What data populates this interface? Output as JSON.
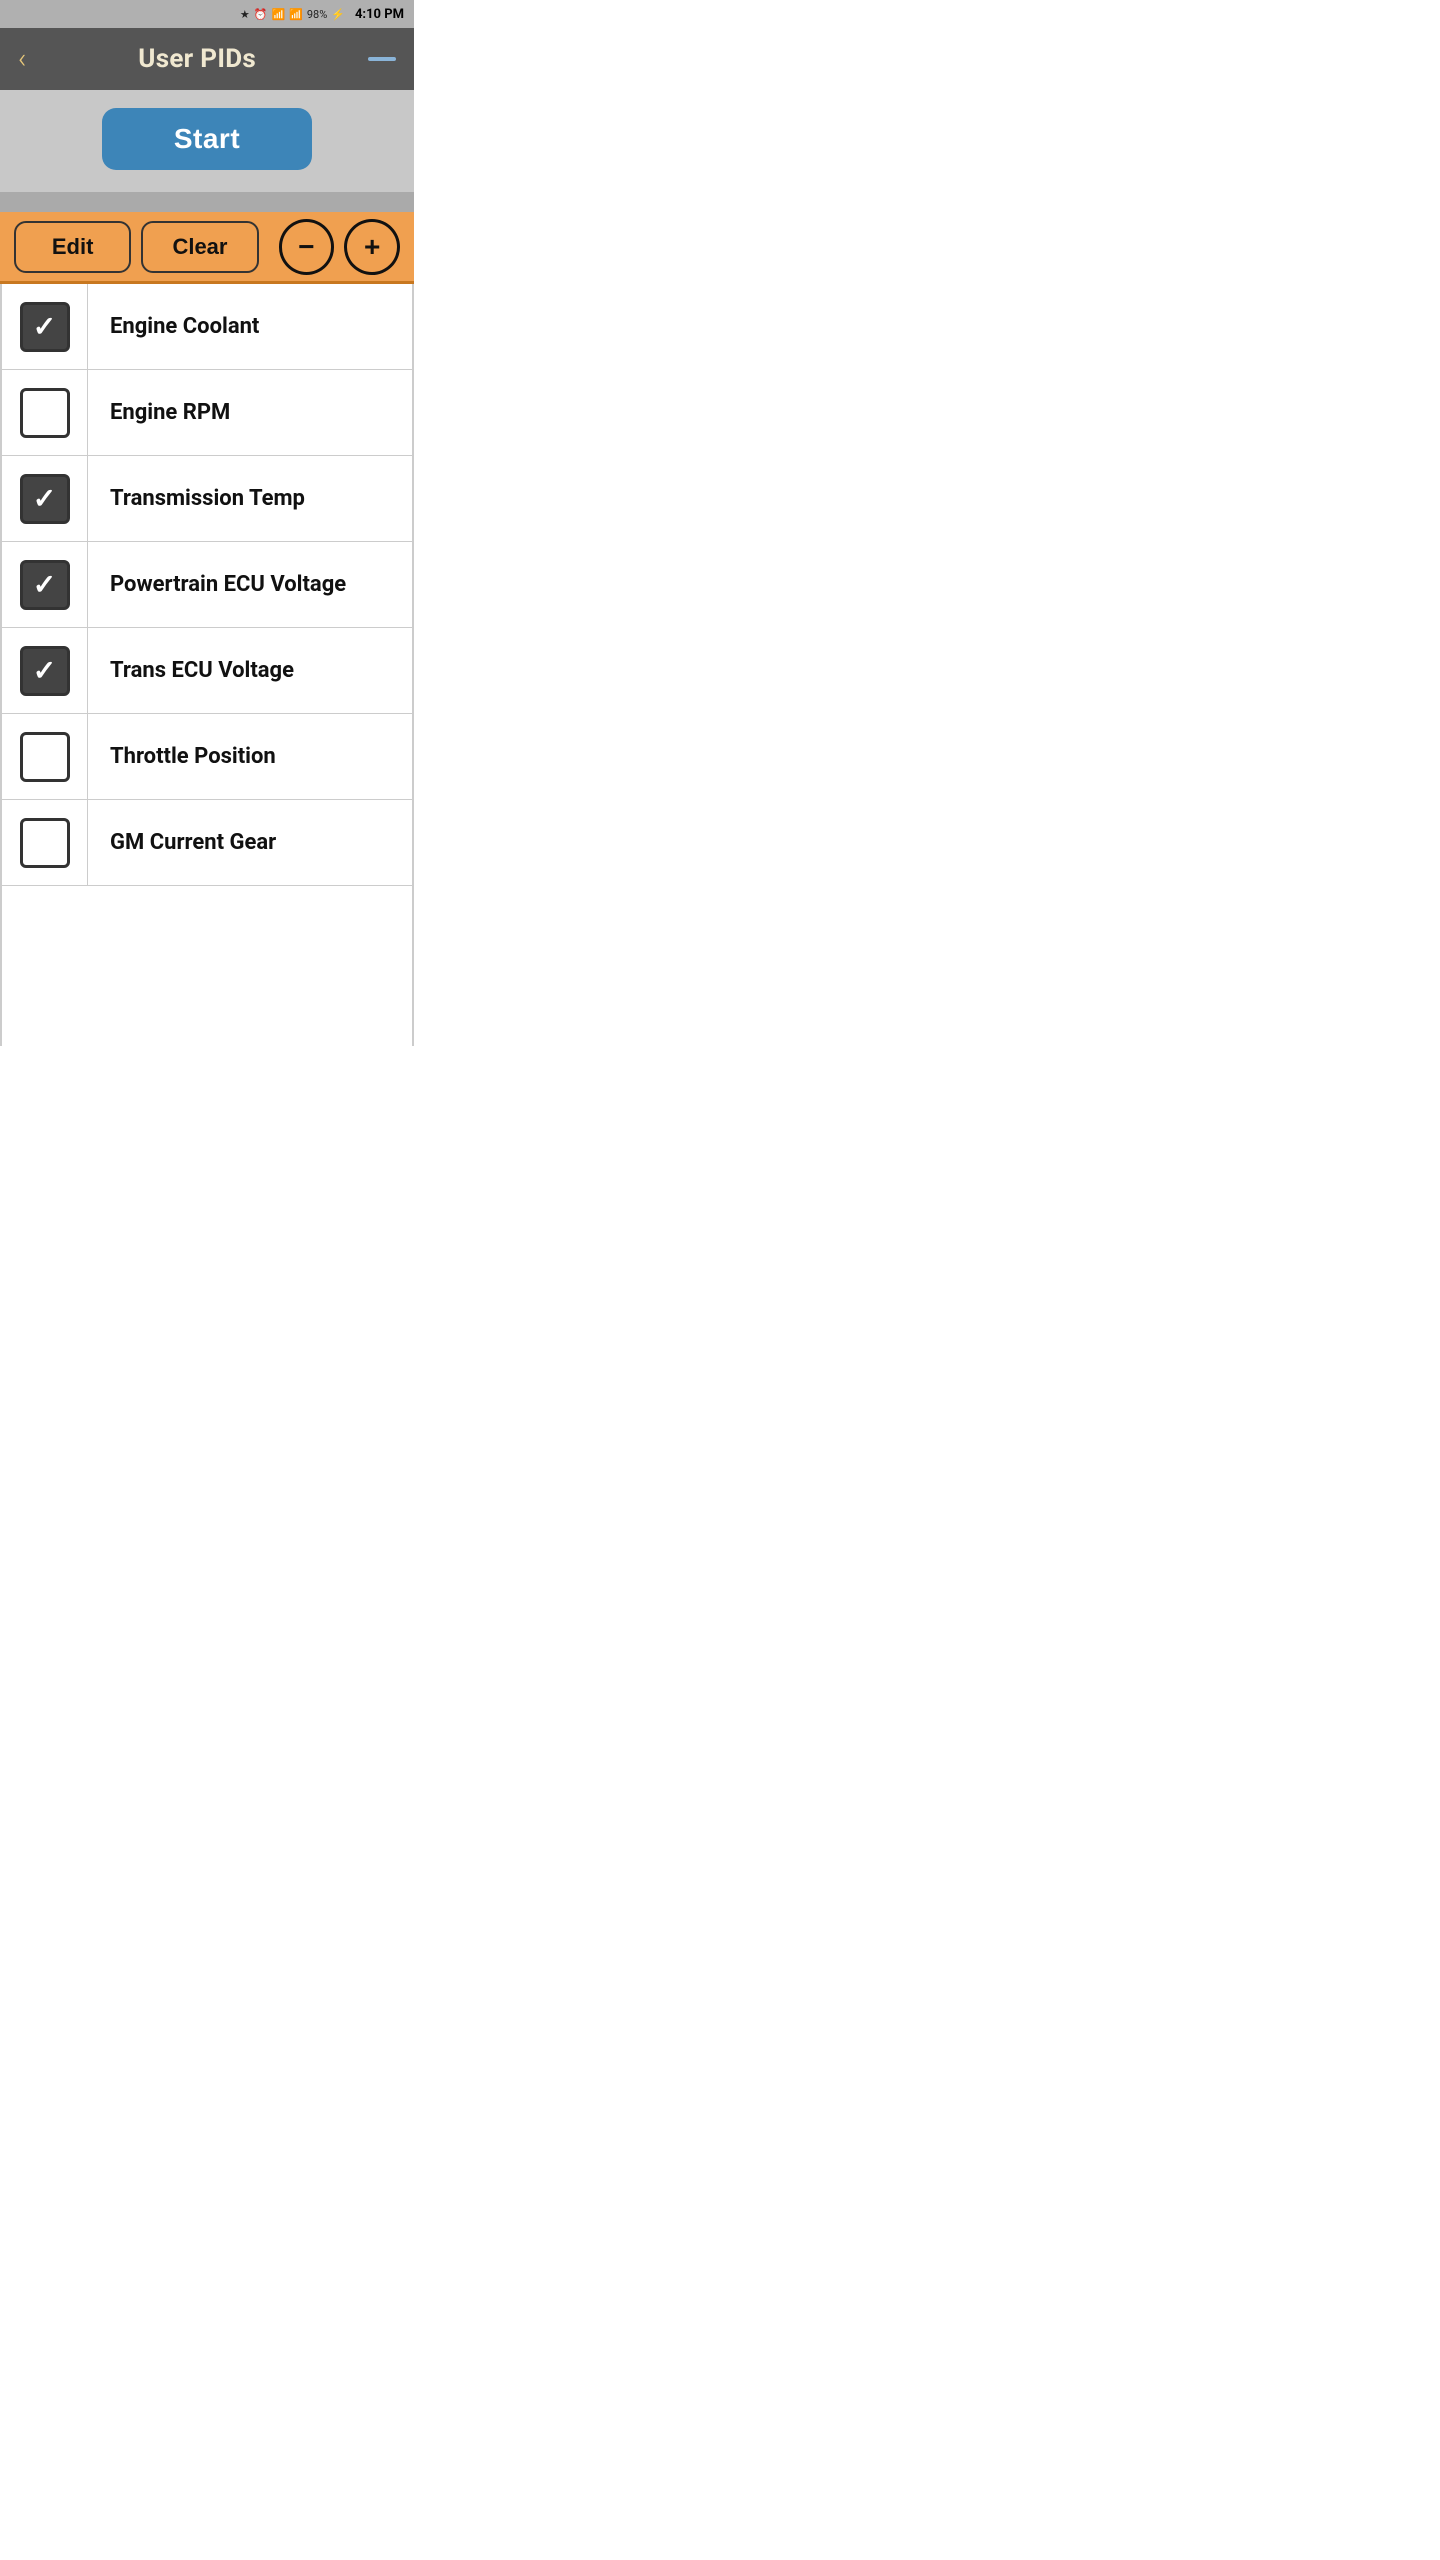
{
  "statusBar": {
    "battery": "98%",
    "time": "4:10 PM",
    "icons": [
      "bluetooth",
      "alarm",
      "wifi",
      "signal-bars"
    ]
  },
  "navBar": {
    "title": "User PIDs",
    "backLabel": "‹",
    "minimizeLabel": "—"
  },
  "startButton": {
    "label": "Start"
  },
  "toolbar": {
    "editLabel": "Edit",
    "clearLabel": "Clear",
    "decrementLabel": "−",
    "incrementLabel": "+"
  },
  "pidList": [
    {
      "id": 1,
      "label": "Engine Coolant",
      "checked": true
    },
    {
      "id": 2,
      "label": "Engine RPM",
      "checked": false
    },
    {
      "id": 3,
      "label": "Transmission Temp",
      "checked": true
    },
    {
      "id": 4,
      "label": "Powertrain ECU Voltage",
      "checked": true
    },
    {
      "id": 5,
      "label": "Trans ECU Voltage",
      "checked": true
    },
    {
      "id": 6,
      "label": "Throttle Position",
      "checked": false
    },
    {
      "id": 7,
      "label": "GM Current Gear",
      "checked": false
    }
  ]
}
